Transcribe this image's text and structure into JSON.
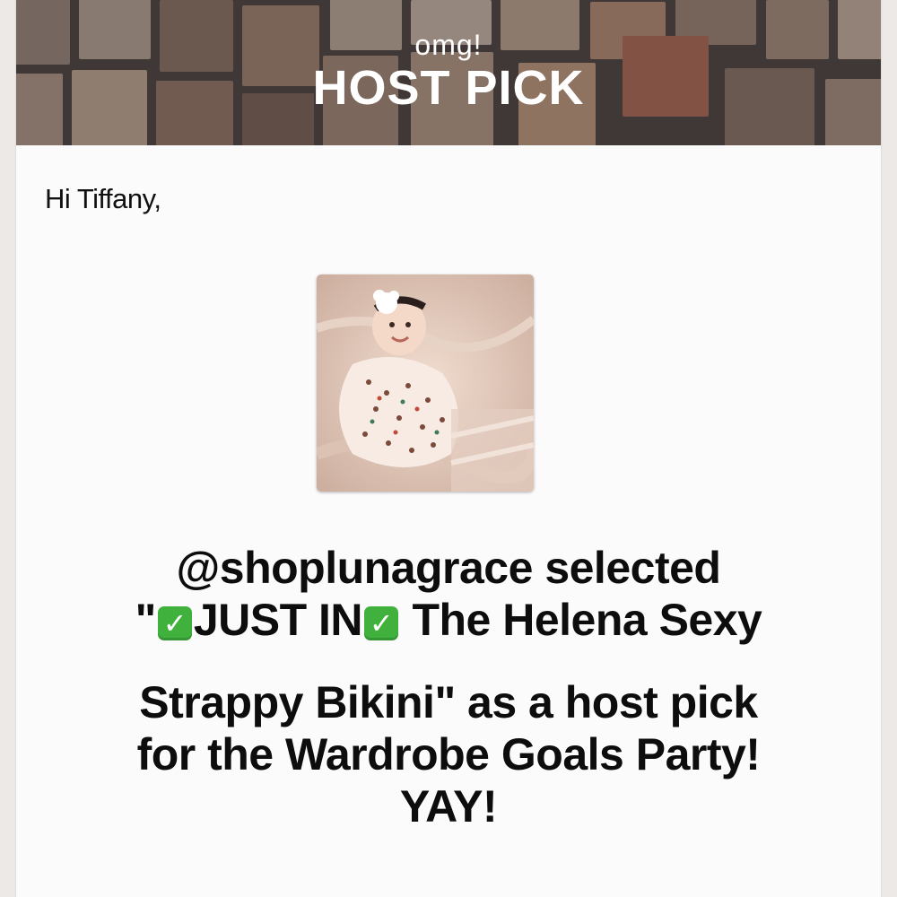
{
  "banner": {
    "kicker": "omg!",
    "title": "HOST PICK"
  },
  "greeting": "Hi Tiffany,",
  "product_image": {
    "description_icon": "baby-photo-image"
  },
  "message": {
    "line1": "@shoplunagrace selected",
    "line2_prefix": "\"",
    "line2_mid": "JUST IN",
    "line2_suffix": " The Helena Sexy",
    "line3": "Strappy Bikini\" as a host pick",
    "line4": "for the Wardrobe Goals Party!",
    "line5": "YAY!",
    "check_glyph": "✓"
  },
  "colors": {
    "check_green": "#3fb13c",
    "banner_overlay": "#4a4340"
  }
}
